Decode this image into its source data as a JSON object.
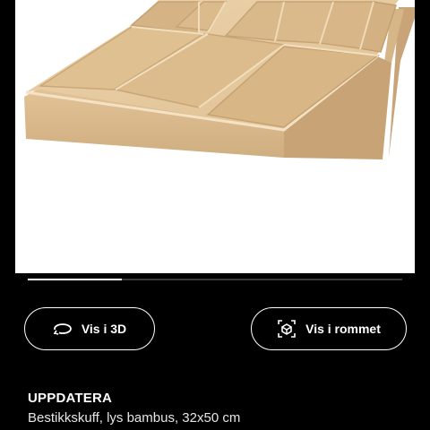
{
  "product_image": {
    "icon": "bamboo-cutlery-tray-image",
    "colors": {
      "background": "#ffffff",
      "bamboo_light": "#e9cfa6",
      "bamboo_mid": "#d9b88b",
      "bamboo_dark": "#c09a6b"
    }
  },
  "gallery": {
    "progress_fraction": 0.25
  },
  "actions": {
    "view_3d_label": "Vis i 3D",
    "view_3d_icon": "rotate-3d-icon",
    "view_room_label": "Vis i rommet",
    "view_room_icon": "ar-room-icon"
  },
  "product": {
    "name": "UPPDATERA",
    "description": "Bestikkskuff, lys bambus, 32x50 cm"
  }
}
